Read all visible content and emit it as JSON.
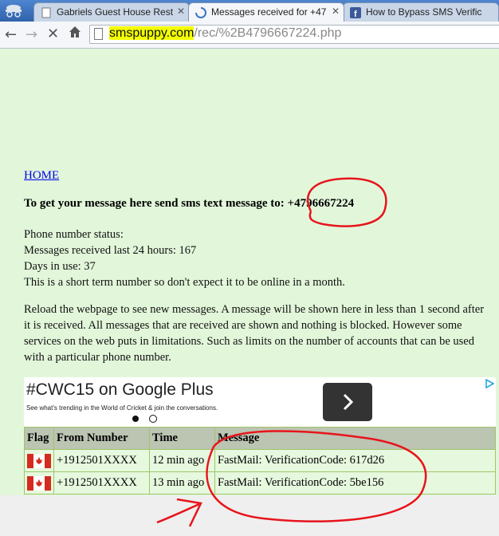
{
  "browser": {
    "tabs": [
      {
        "title": "Gabriels Guest House Rest"
      },
      {
        "title": "Messages received for +47"
      },
      {
        "title": "How to Bypass SMS Verific"
      }
    ],
    "url_domain": "smspuppy.com",
    "url_path": "/rec/%2B4796667224.php"
  },
  "page": {
    "home_link": "HOME",
    "send_text": "To get your message here send sms text message to:",
    "phone_number": "+4796667224",
    "status_lines": [
      "Phone number status:",
      "Messages received last 24 hours: 167",
      "Days in use: 37",
      "This is a short term number so don't expect it to be online in a month."
    ],
    "reload_text": "Reload the webpage to see new messages. A message will be shown here in less than 1 second after it is received. All messages that are received are shown and nothing is blocked. However some services on the web puts in limitations. Such as limits on the number of accounts that can be used with a particular phone number."
  },
  "ad": {
    "title": "#CWC15 on Google Plus",
    "subtitle": "See what's trending in the World of Cricket & join the conversations."
  },
  "table": {
    "headers": [
      "Flag",
      "From Number",
      "Time",
      "Message"
    ],
    "rows": [
      {
        "from": "+1912501XXXX",
        "time": "12 min ago",
        "message": "FastMail: VerificationCode: 617d26"
      },
      {
        "from": "+1912501XXXX",
        "time": "13 min ago",
        "message": "FastMail: VerificationCode: 5be156"
      }
    ]
  },
  "colors": {
    "page_background": "#e2f7da",
    "annotation_red": "#e8141c",
    "url_highlight": "#f3ff00"
  }
}
